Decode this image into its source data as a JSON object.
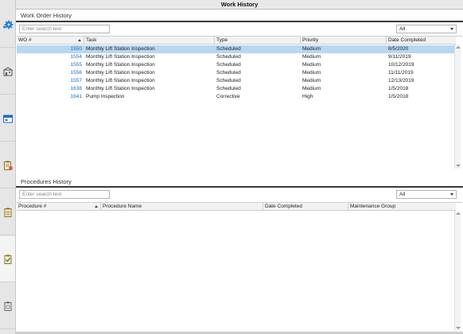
{
  "window": {
    "title": "Work History"
  },
  "sidebar": {
    "items": [
      {
        "name": "settings-gear"
      },
      {
        "name": "facility"
      },
      {
        "name": "calendar"
      },
      {
        "name": "work-order-clipboard"
      },
      {
        "name": "procedures-clipboard"
      },
      {
        "name": "checked-clipboard"
      },
      {
        "name": "copy-clipboard"
      }
    ]
  },
  "work_orders": {
    "title": "Work Order History",
    "search_placeholder": "Enter search text",
    "filter_value": "All",
    "columns": [
      "WO #",
      "Task",
      "Type",
      "Priority",
      "Date Completed"
    ],
    "rows": [
      {
        "wo": "1550",
        "task": "Monthly Lift Station Inspection",
        "type": "Scheduled",
        "priority": "Medium",
        "date": "8/5/2020"
      },
      {
        "wo": "1554",
        "task": "Monthly Lift Station Inspection",
        "type": "Scheduled",
        "priority": "Medium",
        "date": "9/11/2019"
      },
      {
        "wo": "1555",
        "task": "Monthly Lift Station Inspection",
        "type": "Scheduled",
        "priority": "Medium",
        "date": "10/12/2019"
      },
      {
        "wo": "1556",
        "task": "Monthly Lift Station Inspection",
        "type": "Scheduled",
        "priority": "Medium",
        "date": "11/11/2019"
      },
      {
        "wo": "1557",
        "task": "Monthly Lift Station Inspection",
        "type": "Scheduled",
        "priority": "Medium",
        "date": "12/13/2019"
      },
      {
        "wo": "1638",
        "task": "Monthly Lift Station Inspection",
        "type": "Scheduled",
        "priority": "Medium",
        "date": "1/5/2018"
      },
      {
        "wo": "1641",
        "task": "Pump Inspection",
        "type": "Corrective",
        "priority": "High",
        "date": "1/5/2018"
      }
    ]
  },
  "procedures": {
    "title": "Procedures History",
    "search_placeholder": "Enter search text",
    "filter_value": "All",
    "columns": [
      "Procedure #",
      "Procedure Name",
      "Date Completed",
      "Maintenance Group"
    ]
  },
  "colors": {
    "selected_row": "#b8d7f1",
    "link_number": "#1a6fc4",
    "accent_blue": "#1e7fd6"
  }
}
